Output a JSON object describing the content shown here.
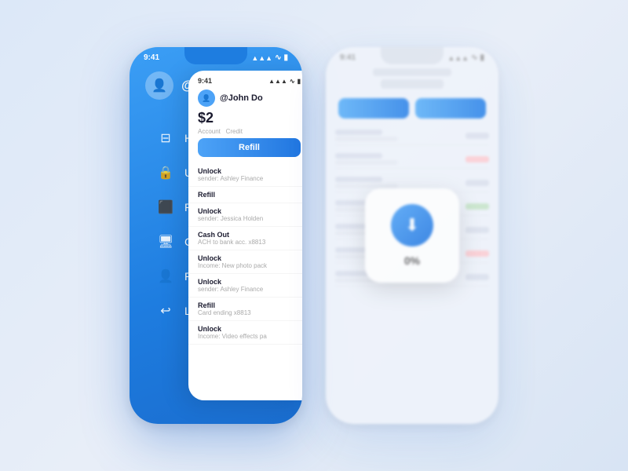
{
  "left_phone": {
    "status_bar": {
      "time": "9:41",
      "signal": "▲▲▲",
      "wifi": "WiFi",
      "battery": "🔋"
    },
    "user_name": "@John Doe",
    "nav_items": [
      {
        "id": "history",
        "label": "History",
        "icon": "☰"
      },
      {
        "id": "unlock",
        "label": "Unlock operations",
        "icon": "🔒"
      },
      {
        "id": "refill",
        "label": "Refill operations",
        "icon": "💳"
      },
      {
        "id": "cashout",
        "label": "Cash out operations",
        "icon": "🖥"
      },
      {
        "id": "profile",
        "label": "Profile",
        "icon": "👤"
      },
      {
        "id": "logout",
        "label": "Logout",
        "icon": "↩"
      }
    ]
  },
  "overlay_card": {
    "time": "9:41",
    "user_name": "@John Do",
    "amount": "$2",
    "account_label": "Account",
    "credit_label": "Credit",
    "refill_label": "Refill",
    "list_items": [
      {
        "title": "Unlock",
        "sub": "sender: Ashley Finance"
      },
      {
        "title": "Refill",
        "sub": ""
      },
      {
        "title": "Unlock",
        "sub": "sender: Jessica Holden"
      },
      {
        "title": "Cash Out",
        "sub": "ACH to bank acc. x8813"
      },
      {
        "title": "Unlock",
        "sub": "Income: New photo pack"
      },
      {
        "title": "Unlock",
        "sub": "sender: Ashley Finance"
      },
      {
        "title": "Refill",
        "sub": "Card ending x8813"
      },
      {
        "title": "Unlock",
        "sub": "Income: Video effects pa"
      }
    ]
  },
  "right_phone": {
    "time": "9:41",
    "list_rows": 7
  },
  "download_modal": {
    "icon": "⬇",
    "percent": "0%"
  }
}
